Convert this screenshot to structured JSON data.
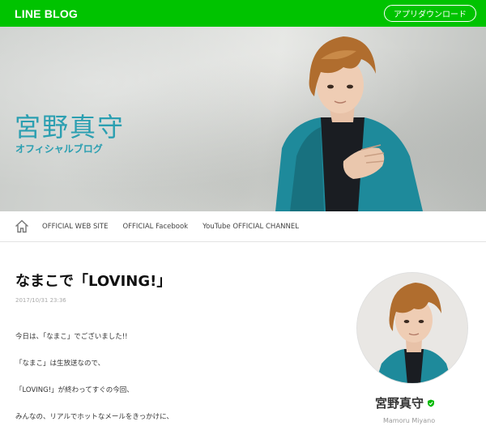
{
  "header": {
    "logo": "LINE BLOG",
    "app_download": "アプリダウンロード"
  },
  "hero": {
    "name": "宮野真守",
    "subtitle": "オフィシャルブログ"
  },
  "nav": {
    "home_icon": "home-icon",
    "links": [
      "OFFICIAL WEB SITE",
      "OFFICIAL Facebook",
      "YouTube OFFICIAL CHANNEL"
    ]
  },
  "article": {
    "title": "なまこで「LOVING!」",
    "date": "2017/10/31 23:36",
    "paragraphs": [
      "今日は、「なまこ」でございました!!",
      "「なまこ」は生放送なので、",
      "「LOVING!」が終わってすぐの今回、",
      "みんなの、リアルでホットなメールをきっかけに、"
    ]
  },
  "profile": {
    "name": "宮野真守",
    "romaji": "Mamoru Miyano",
    "verified_icon": "verified-shield-icon"
  },
  "colors": {
    "brand_green": "#00c300",
    "accent_teal": "#2b9fb1"
  }
}
